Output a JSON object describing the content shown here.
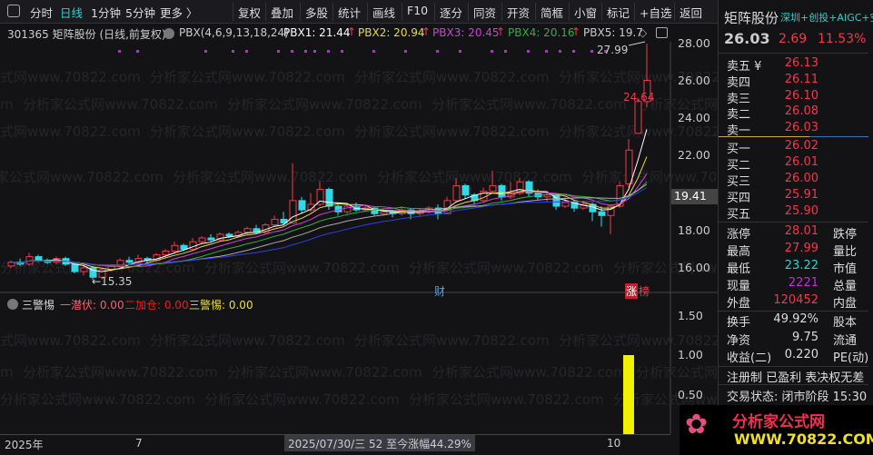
{
  "toolbar": {
    "items": [
      "分时",
      "日线",
      "1分钟",
      "5分钟",
      "更多 〉"
    ],
    "buttons": [
      "复权",
      "叠加",
      "多股",
      "统计",
      "画线",
      "F10",
      "逐分",
      "同资",
      "开资",
      "简框",
      "小窗",
      "标记",
      "+自选",
      "返回"
    ]
  },
  "info": {
    "code_name": "301365 矩阵股份 (日线,前复权)",
    "indicator": "PBX(4,6,9,13,18,24)",
    "pbx": [
      {
        "label": "PBX1: 21.44",
        "color": "#ffffff"
      },
      {
        "label": "PBX2: 20.94",
        "color": "#e8d840"
      },
      {
        "label": "PBX3: 20.45",
        "color": "#d040d8"
      },
      {
        "label": "PBX4: 20.16",
        "color": "#30b040"
      },
      {
        "label": "PBX5: 19.7",
        "color": "#cccccc"
      }
    ]
  },
  "price_axis": [
    "28.00",
    "26.00",
    "24.00",
    "22.00",
    "20.00",
    "18.00",
    "16.00"
  ],
  "current_price_tag": "19.41",
  "annotations": {
    "high": "27.99",
    "mid": "24.64",
    "low": "←15.35",
    "cai": "财",
    "zhang": "涨",
    "bang": "榜"
  },
  "indicator": {
    "name": "三警惕",
    "l1": "一潜伏: 0.00",
    "l2": "二加仓: 0.00",
    "l3": "三警惕: 0.00",
    "axis": [
      "1.50",
      "1.00",
      "0.50"
    ]
  },
  "bottom_axis": {
    "year": "2025年",
    "m7": "7",
    "cursor": "2025/07/30/三 52 至今涨幅44.29%",
    "m10": "10"
  },
  "watermark": "分析家公式网www.70822.com",
  "panel": {
    "name": "矩阵股份",
    "tags": "深圳+创投+AIGC+空",
    "price": "26.03",
    "change": "2.69",
    "pct": "11.53%",
    "asks": [
      [
        "卖五 ¥",
        "26.13"
      ],
      [
        "卖四",
        "26.11"
      ],
      [
        "卖三",
        "26.10"
      ],
      [
        "卖二",
        "26.08"
      ],
      [
        "卖一",
        "26.03"
      ]
    ],
    "bids": [
      [
        "买一",
        "26.02"
      ],
      [
        "买二",
        "26.01"
      ],
      [
        "买三",
        "26.00"
      ],
      [
        "买四",
        "25.91"
      ],
      [
        "买五",
        "25.90"
      ]
    ],
    "stats": [
      [
        "涨停",
        "28.01",
        "#f0384a",
        "跌停"
      ],
      [
        "最高",
        "27.99",
        "#f0384a",
        "量比"
      ],
      [
        "最低",
        "23.22",
        "#30d0c8",
        "市值"
      ],
      [
        "现量",
        "2221",
        "#c030d0",
        "总量"
      ],
      [
        "外盘",
        "120452",
        "#f0384a",
        "内盘"
      ]
    ],
    "stats2": [
      [
        "换手",
        "49.92%",
        "股本"
      ],
      [
        "净资",
        "9.75",
        "流通"
      ],
      [
        "收益(二)",
        "0.220",
        "PE(动)"
      ]
    ],
    "note": "注册制 已盈利 表决权无差",
    "status": "交易状态: 闭市阶段 15:30"
  },
  "logo": {
    "title": "分析家公式网",
    "url": "WWW.70822.COM"
  },
  "chart_data": {
    "type": "candlestick",
    "ylim": [
      15,
      28.5
    ],
    "ohlc": [
      [
        16.1,
        16.3,
        16.4,
        16.0
      ],
      [
        16.3,
        16.2,
        16.5,
        16.1
      ],
      [
        16.2,
        16.6,
        16.8,
        16.1
      ],
      [
        16.6,
        16.4,
        16.7,
        16.3
      ],
      [
        16.4,
        16.3,
        16.5,
        16.2
      ],
      [
        16.3,
        16.5,
        16.6,
        16.2
      ],
      [
        16.5,
        16.2,
        16.6,
        16.1
      ],
      [
        16.2,
        15.8,
        16.3,
        15.7
      ],
      [
        15.8,
        16.0,
        16.1,
        15.6
      ],
      [
        16.0,
        15.5,
        16.1,
        15.35
      ],
      [
        15.5,
        15.9,
        16.0,
        15.4
      ],
      [
        15.9,
        16.1,
        16.2,
        15.8
      ],
      [
        16.1,
        16.4,
        16.5,
        16.0
      ],
      [
        16.4,
        16.3,
        16.6,
        16.2
      ],
      [
        16.3,
        16.5,
        16.7,
        16.2
      ],
      [
        16.5,
        16.4,
        16.6,
        16.3
      ],
      [
        16.4,
        16.7,
        16.8,
        16.3
      ],
      [
        16.7,
        16.9,
        17.0,
        16.6
      ],
      [
        16.9,
        17.2,
        17.4,
        16.8
      ],
      [
        17.2,
        17.0,
        17.3,
        16.9
      ],
      [
        17.0,
        17.4,
        17.6,
        16.9
      ],
      [
        17.4,
        17.6,
        17.7,
        17.3
      ],
      [
        17.6,
        17.5,
        17.8,
        17.4
      ],
      [
        17.5,
        17.8,
        17.9,
        17.4
      ],
      [
        17.8,
        17.7,
        17.9,
        17.6
      ],
      [
        17.7,
        17.9,
        18.0,
        17.6
      ],
      [
        17.9,
        18.1,
        18.2,
        17.8
      ],
      [
        18.1,
        17.9,
        18.3,
        17.8
      ],
      [
        17.9,
        18.3,
        18.4,
        17.8
      ],
      [
        18.3,
        18.6,
        18.8,
        18.2
      ],
      [
        18.6,
        18.4,
        19.0,
        18.3
      ],
      [
        18.4,
        19.6,
        21.6,
        18.4
      ],
      [
        19.6,
        19.1,
        19.8,
        18.9
      ],
      [
        19.1,
        19.4,
        20.0,
        19.0
      ],
      [
        19.4,
        20.2,
        20.6,
        19.3
      ],
      [
        20.2,
        19.3,
        20.3,
        19.1
      ],
      [
        19.3,
        19.0,
        19.5,
        18.8
      ],
      [
        19.0,
        19.3,
        19.4,
        18.9
      ],
      [
        19.3,
        19.1,
        19.5,
        19.0
      ],
      [
        19.1,
        19.2,
        19.4,
        19.0
      ],
      [
        19.2,
        18.9,
        19.3,
        18.8
      ],
      [
        18.9,
        19.0,
        19.2,
        18.8
      ],
      [
        19.0,
        18.9,
        19.1,
        18.7
      ],
      [
        18.9,
        19.1,
        19.3,
        18.8
      ],
      [
        19.1,
        18.9,
        19.2,
        18.6
      ],
      [
        18.9,
        19.0,
        19.2,
        18.8
      ],
      [
        19.0,
        19.2,
        19.3,
        18.9
      ],
      [
        19.2,
        18.9,
        19.4,
        18.6
      ],
      [
        18.9,
        19.6,
        19.8,
        18.9
      ],
      [
        19.6,
        20.4,
        20.8,
        19.5
      ],
      [
        20.4,
        19.9,
        20.5,
        19.7
      ],
      [
        19.9,
        19.6,
        20.0,
        19.4
      ],
      [
        19.6,
        20.1,
        20.3,
        19.5
      ],
      [
        20.1,
        20.4,
        21.2,
        20.0
      ],
      [
        20.4,
        19.8,
        20.5,
        19.6
      ],
      [
        19.8,
        20.0,
        20.6,
        19.7
      ],
      [
        20.0,
        20.6,
        20.8,
        19.9
      ],
      [
        20.6,
        20.0,
        20.7,
        19.8
      ],
      [
        20.0,
        19.8,
        20.2,
        19.6
      ],
      [
        19.8,
        19.9,
        20.1,
        19.5
      ],
      [
        19.9,
        19.3,
        20.0,
        19.1
      ],
      [
        19.3,
        19.5,
        19.8,
        19.2
      ],
      [
        19.5,
        19.2,
        19.6,
        19.0
      ],
      [
        19.2,
        19.4,
        19.6,
        19.1
      ],
      [
        19.4,
        19.0,
        19.5,
        18.5
      ],
      [
        19.0,
        18.8,
        19.3,
        18.2
      ],
      [
        18.8,
        19.3,
        19.4,
        17.8
      ],
      [
        19.3,
        20.4,
        20.6,
        19.2
      ],
      [
        20.5,
        22.3,
        22.9,
        20.3
      ],
      [
        23.2,
        24.9,
        25.1,
        23.2
      ],
      [
        24.9,
        26.03,
        27.99,
        24.6
      ]
    ],
    "ma_periods": [
      4,
      6,
      9,
      13,
      18,
      24
    ],
    "ma_colors": [
      "#ffffff",
      "#e8d840",
      "#d040d8",
      "#30b040",
      "#aaaaaa",
      "#3040e0"
    ],
    "up_color": "#f0384a",
    "down_color": "#30d8e8",
    "indicator_bars": [
      {
        "index": 68,
        "value": 1.0
      }
    ],
    "indicator_ylim": [
      0,
      1.7
    ]
  }
}
